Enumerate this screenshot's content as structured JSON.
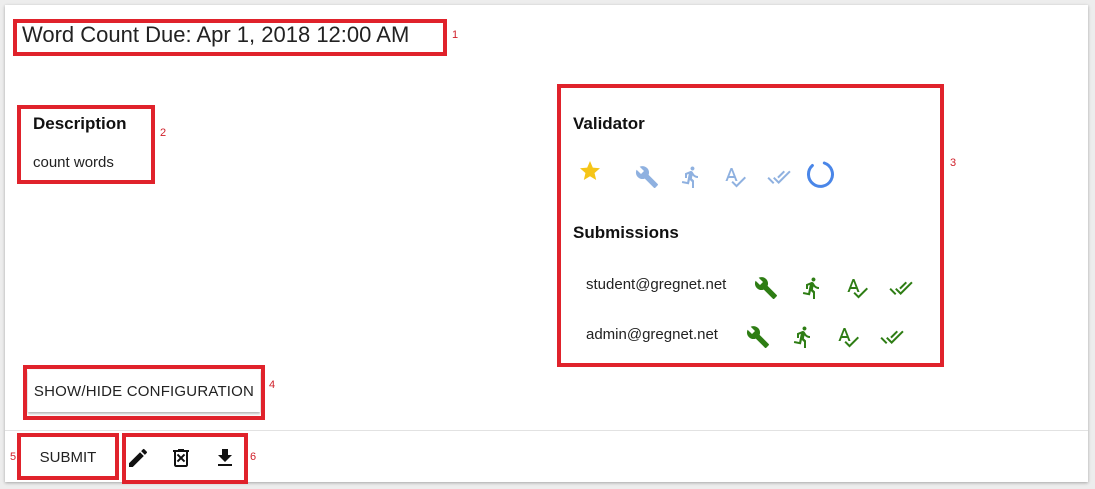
{
  "header": {
    "title": "Word Count Due: Apr 1, 2018 12:00 AM"
  },
  "description": {
    "heading": "Description",
    "text": "count words"
  },
  "validator": {
    "heading": "Validator",
    "icons": [
      "star-icon",
      "wrench-icon",
      "run-icon",
      "spellcheck-icon",
      "done-all-icon",
      "loading-spinner"
    ],
    "icon_color": "#8fb1e0",
    "star_color": "#f5c518",
    "spinner_color": "#4a86e8"
  },
  "submissions": {
    "heading": "Submissions",
    "icon_color": "#2e7d14",
    "items": [
      {
        "email": "student@gregnet.net",
        "icons": [
          "wrench-icon",
          "run-icon",
          "spellcheck-icon",
          "done-all-icon"
        ]
      },
      {
        "email": "admin@gregnet.net",
        "icons": [
          "wrench-icon",
          "run-icon",
          "spellcheck-icon",
          "done-all-icon"
        ]
      }
    ]
  },
  "buttons": {
    "config_label": "SHOW/HIDE CONFIGURATION",
    "submit_label": "SUBMIT"
  },
  "actions": {
    "icons": [
      "edit-icon",
      "delete-icon",
      "download-icon"
    ]
  },
  "annotations": {
    "color": "#e0222b",
    "labels": [
      "1",
      "2",
      "3",
      "4",
      "5",
      "6"
    ]
  }
}
